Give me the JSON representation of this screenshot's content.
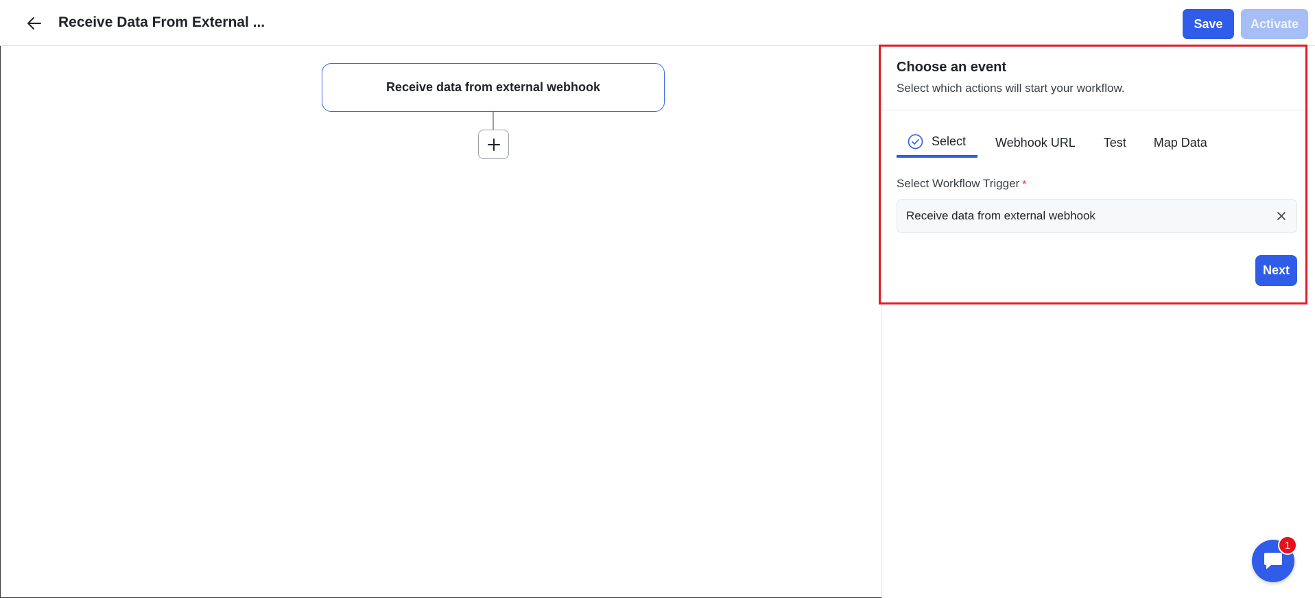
{
  "header": {
    "title": "Receive Data From External ...",
    "save_label": "Save",
    "activate_label": "Activate",
    "back_icon": "arrow-left-icon"
  },
  "canvas": {
    "trigger_node_label": "Receive data from external webhook",
    "add_icon": "plus-icon"
  },
  "panel": {
    "title": "Choose an event",
    "subtitle": "Select which actions will start your workflow.",
    "tabs": [
      {
        "label": "Select",
        "active": true,
        "icon": "check-circle-icon"
      },
      {
        "label": "Webhook URL",
        "active": false
      },
      {
        "label": "Test",
        "active": false
      },
      {
        "label": "Map Data",
        "active": false
      }
    ],
    "field_label": "Select Workflow Trigger",
    "field_required": "*",
    "field_value": "Receive data from external webhook",
    "next_label": "Next"
  },
  "chat": {
    "icon": "chat-bubble-icon",
    "badge_count": "1"
  },
  "colors": {
    "accent": "#2f5ce8",
    "accent_disabled": "#a7bdf5",
    "highlight": "#e01b24",
    "badge": "#e8111b"
  }
}
